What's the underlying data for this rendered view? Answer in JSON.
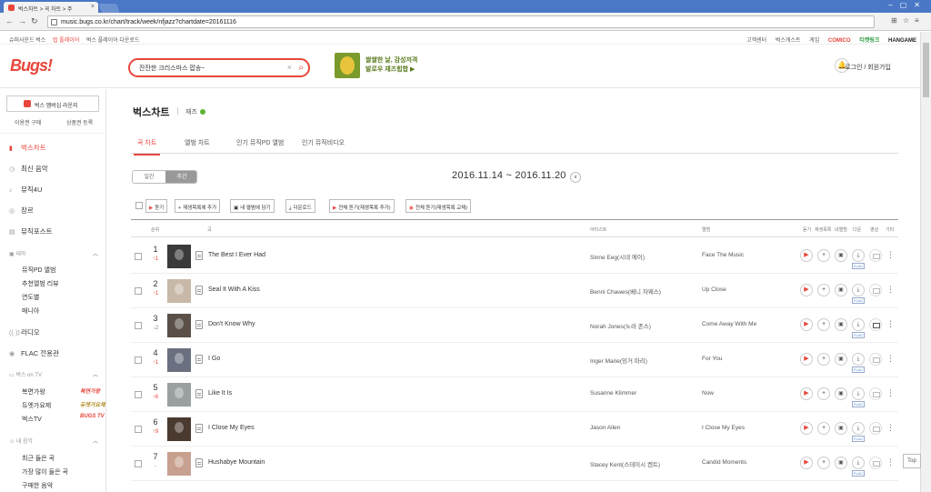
{
  "browser": {
    "tab_title": "벅스차트 > 곡 차트 > 주",
    "url": "music.bugs.co.kr/chart/track/week/nfjazz?chartdate=20161116"
  },
  "util": {
    "left": [
      "슈퍼사운드 벅스",
      "럽 플레이어",
      "벅스 플레이어 다운로드"
    ],
    "right": [
      "고객센터",
      "벅스캐스트",
      "게임",
      "COMICO",
      "티켓링크",
      "HANGAME"
    ]
  },
  "header": {
    "logo": "Bugs!",
    "search_value": "잔잔한 크리스마스 팝송~",
    "promo_line1": "쌀쌀한 날, 감성저격",
    "promo_line2": "발로우 재즈힙합",
    "login": "로그인 / 회원가입"
  },
  "sidebar": {
    "membership": "벅스 멤버십 라운지",
    "sub_links": [
      "이용권 구매",
      "상품권 등록"
    ],
    "items": [
      "벅스차트",
      "최신 음악",
      "뮤직4U",
      "장르",
      "뮤직포스트"
    ],
    "theme_label": "테마",
    "theme_items": [
      "뮤직PD 앨범",
      "추천앨범 리뷰",
      "연도별",
      "매니아"
    ],
    "radio": "라디오",
    "flac": "FLAC 전용관",
    "bugs_tv_label": "벅스 on TV",
    "tv_items": [
      "복면가왕",
      "듀엣가요제",
      "벅스TV"
    ],
    "tv_badges": [
      "복면가왕",
      "듀엣가요제",
      "BUGS TV"
    ],
    "my_music_label": "내 음악",
    "my_items": [
      "최근 들은 곡",
      "가장 많이 들은 곡",
      "구매한 음악"
    ]
  },
  "main": {
    "title": "벅스차트",
    "genre": "재즈",
    "tabs": [
      "곡 차트",
      "앨범 차트",
      "인기 뮤직PD 앨범",
      "인기 뮤직비디오"
    ],
    "seg_daily": "일간",
    "seg_weekly": "주간",
    "date_range": "2016.11.14 ~ 2016.11.20",
    "actions": [
      "듣기",
      "재생목록에 추가",
      "내 앨범에 담기",
      "다운로드",
      "전체 듣기(재생목록 추가)",
      "전체 듣기(재생목록 교체)"
    ],
    "headers": [
      "순위",
      "곡",
      "아티스트",
      "앨범",
      "듣기",
      "재생목록",
      "내앨범",
      "다운",
      "영상",
      "기타"
    ],
    "rows": [
      {
        "rank": "1",
        "change": "↑1",
        "dir": "up",
        "song": "The Best I Ever Had",
        "artist": "Sinne Eeg(시네 에이)",
        "album": "Face The Music",
        "art": "#3a3a3a",
        "mv": false
      },
      {
        "rank": "2",
        "change": "↑1",
        "dir": "up",
        "song": "Seal It With A Kiss",
        "artist": "Benni Chawes(베니 차웨스)",
        "album": "Up Close",
        "art": "#c8b8a8",
        "mv": false
      },
      {
        "rank": "3",
        "change": "↓2",
        "dir": "down",
        "song": "Don't Know Why",
        "artist": "Norah Jones(노라 존스)",
        "album": "Come Away With Me",
        "art": "#5a5048",
        "mv": true
      },
      {
        "rank": "4",
        "change": "↑1",
        "dir": "up",
        "song": "I Go",
        "artist": "Inger Marie(잉거 마리)",
        "album": "For You",
        "art": "#6a7080",
        "mv": false
      },
      {
        "rank": "5",
        "change": "↑6",
        "dir": "up",
        "song": "Like It Is",
        "artist": "Susanne Klimmer",
        "album": "Now",
        "art": "#9aa0a0",
        "mv": false
      },
      {
        "rank": "6",
        "change": "↑9",
        "dir": "up",
        "song": "I Close My Eyes",
        "artist": "Jason Allen",
        "album": "I Close My Eyes",
        "art": "#4a3a30",
        "mv": false
      },
      {
        "rank": "7",
        "change": "-",
        "dir": "same",
        "song": "Hushabye Mountain",
        "artist": "Stacey Kent(스테이시 켄트)",
        "album": "Candid Moments",
        "art": "#c8a090",
        "mv": false
      }
    ]
  },
  "top_button": "Top",
  "colors": {
    "accent": "#e8463c",
    "genre_dot": "#5ab432"
  }
}
